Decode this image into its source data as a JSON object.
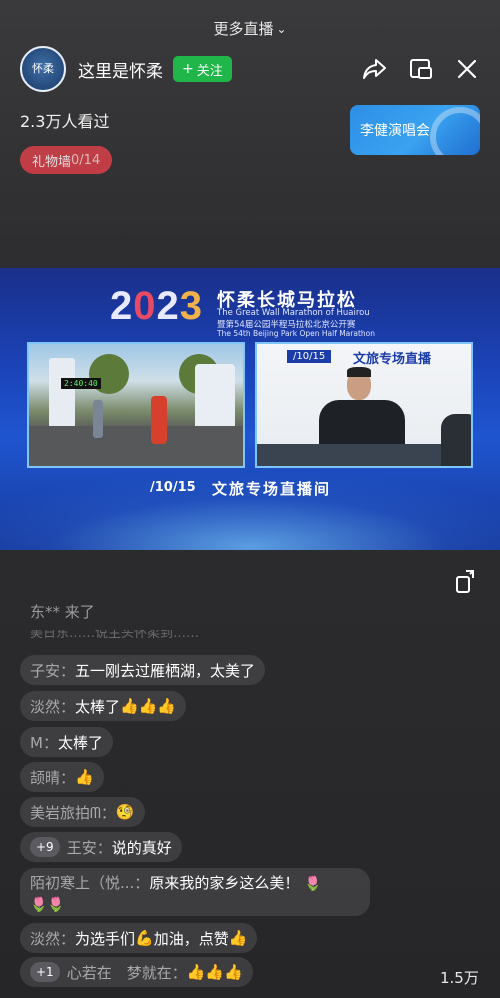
{
  "top": {
    "more_live": "更多直播"
  },
  "header": {
    "avatar_text": "怀柔",
    "channel_name": "这里是怀柔",
    "follow_label": "关注"
  },
  "viewers": "2.3万人看过",
  "gift_wall": {
    "label": "礼物墙 ",
    "count": "0/14"
  },
  "promo": {
    "label": "李健演唱会"
  },
  "video": {
    "year": "2023",
    "title_cn": "怀柔长城马拉松",
    "title_en": "The Great Wall Marathon of Huairou",
    "subtitle_cn": "暨第54届公园半程马拉松北京公开赛",
    "subtitle_en": "The 54th Beijing Park Open Half Marathon",
    "race_clock": "2:40:40",
    "date_small": "/10/15",
    "panel_banner": "文旅专场直播",
    "date_bottom": "/10/15",
    "studio_name": "文旅专场直播间"
  },
  "join_message": "东** 来了",
  "faded_message": "美日东……说主头怀柔到……",
  "comments": [
    {
      "user": "子安：",
      "text": "五一刚去过雁栖湖，太美了"
    },
    {
      "user": "淡然：",
      "text": "太棒了",
      "thumbs": "👍👍👍"
    },
    {
      "user": "M：",
      "text": "太棒了"
    },
    {
      "user": "颉晴：",
      "text": "",
      "thumbs": "👍"
    },
    {
      "user": "美岩旅拍ᗰ：",
      "emoji": "🧐"
    },
    {
      "badge": "+9",
      "user": "王安：",
      "text": "说的真好"
    },
    {
      "user": "陌初寒上（悦...：",
      "text": "原来我的家乡这么美！",
      "flowers": "🌷",
      "flowers2": "🌷🌷"
    },
    {
      "user": "淡然：",
      "text": "为选手们",
      "arm": "💪",
      "text2": "加油，点赞",
      "thumbs": "👍"
    },
    {
      "badge": "+1",
      "user": "心若在　梦就在：",
      "thumbs": "👍👍👍"
    }
  ],
  "like_count": "1.5万"
}
